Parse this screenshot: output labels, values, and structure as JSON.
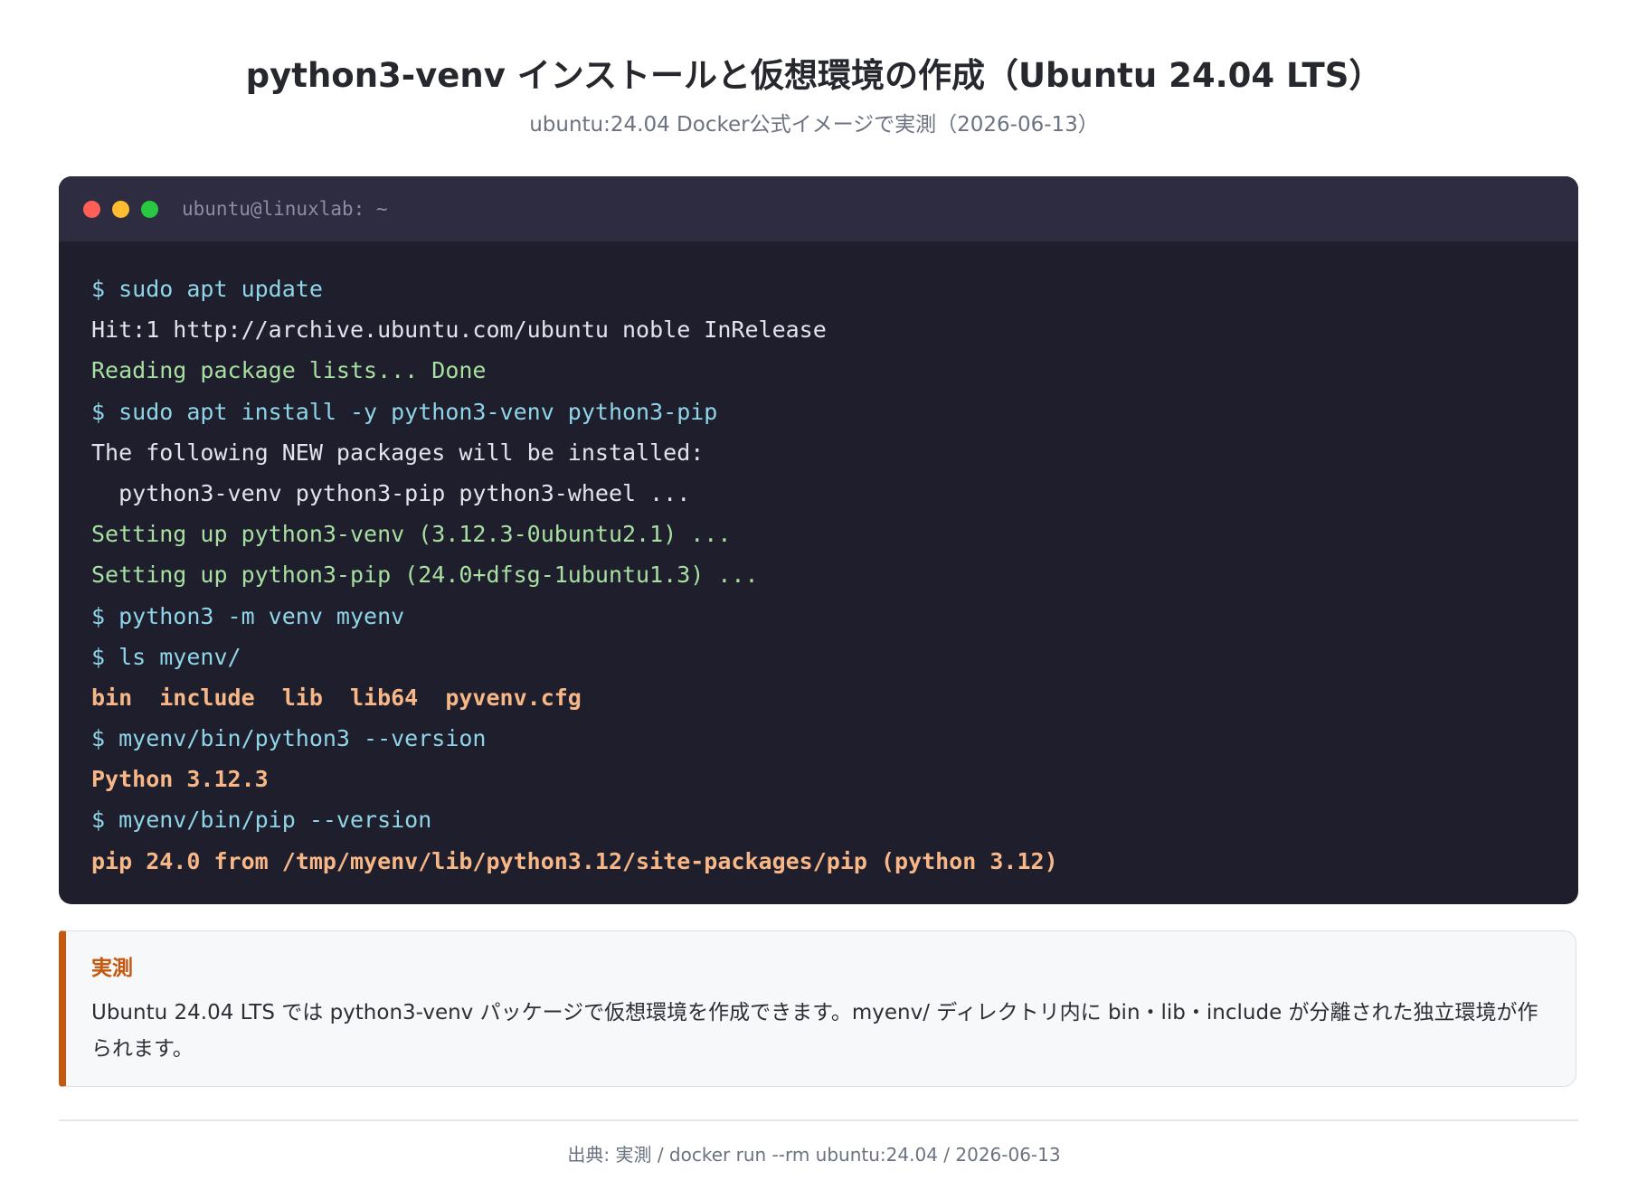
{
  "header": {
    "title": "python3-venv インストールと仮想環境の作成（Ubuntu 24.04 LTS）",
    "subtitle": "ubuntu:24.04 Docker公式イメージで実測（2026-06-13）"
  },
  "terminal": {
    "title": "ubuntu@linuxlab: ~",
    "colors": {
      "background": "#1f1e2c",
      "titlebar": "#2d2c40",
      "command": "#8fd5e8",
      "output": "#e2e4ec",
      "success": "#a7e0a0",
      "highlight": "#f7b787"
    },
    "lines": [
      {
        "kind": "cmd",
        "text": "$ sudo apt update"
      },
      {
        "kind": "out",
        "text": "Hit:1 http://archive.ubuntu.com/ubuntu noble InRelease"
      },
      {
        "kind": "ok",
        "text": "Reading package lists... Done"
      },
      {
        "kind": "cmd",
        "text": "$ sudo apt install -y python3-venv python3-pip"
      },
      {
        "kind": "out",
        "text": "The following NEW packages will be installed:"
      },
      {
        "kind": "out",
        "text": "  python3-venv python3-pip python3-wheel ..."
      },
      {
        "kind": "ok",
        "text": "Setting up python3-venv (3.12.3-0ubuntu2.1) ..."
      },
      {
        "kind": "ok",
        "text": "Setting up python3-pip (24.0+dfsg-1ubuntu1.3) ..."
      },
      {
        "kind": "cmd",
        "text": "$ python3 -m venv myenv"
      },
      {
        "kind": "cmd",
        "text": "$ ls myenv/"
      },
      {
        "kind": "hl",
        "text": "bin  include  lib  lib64  pyvenv.cfg"
      },
      {
        "kind": "cmd",
        "text": "$ myenv/bin/python3 --version"
      },
      {
        "kind": "hl",
        "text": "Python 3.12.3"
      },
      {
        "kind": "cmd",
        "text": "$ myenv/bin/pip --version"
      },
      {
        "kind": "hl",
        "text": "pip 24.0 from /tmp/myenv/lib/python3.12/site-packages/pip (python 3.12)"
      }
    ]
  },
  "note": {
    "label": "実測",
    "text": "Ubuntu 24.04 LTS では python3-venv パッケージで仮想環境を作成できます。myenv/ ディレクトリ内に bin・lib・include が分離された独立環境が作られます。",
    "accent_color": "#c4580f"
  },
  "footer": {
    "source": "出典: 実測 / docker run --rm ubuntu:24.04 / 2026-06-13"
  }
}
